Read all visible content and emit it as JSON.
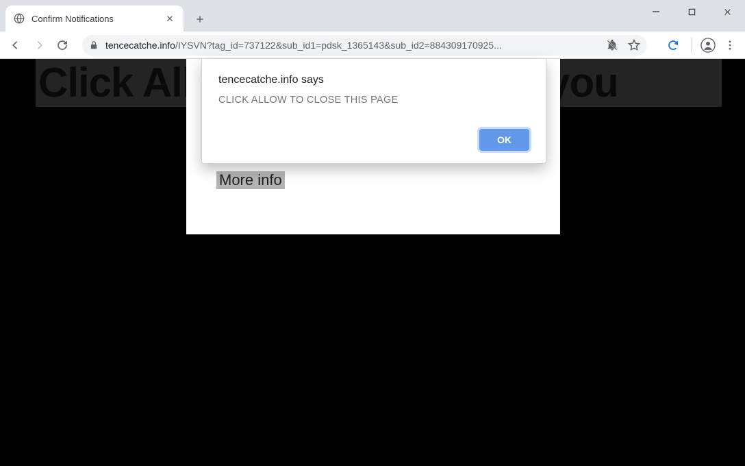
{
  "tab": {
    "title": "Confirm Notifications"
  },
  "url": {
    "domain": "tencecatche.info",
    "rest": "/IYSVN?tag_id=737122&sub_id1=pdsk_1365143&sub_id2=884309170925..."
  },
  "page": {
    "banner_text": "Click Allow to confirm that you",
    "more_info_label": "More info"
  },
  "dialog": {
    "header": "tencecatche.info says",
    "message": "CLICK ALLOW TO CLOSE THIS PAGE",
    "ok_label": "OK"
  }
}
